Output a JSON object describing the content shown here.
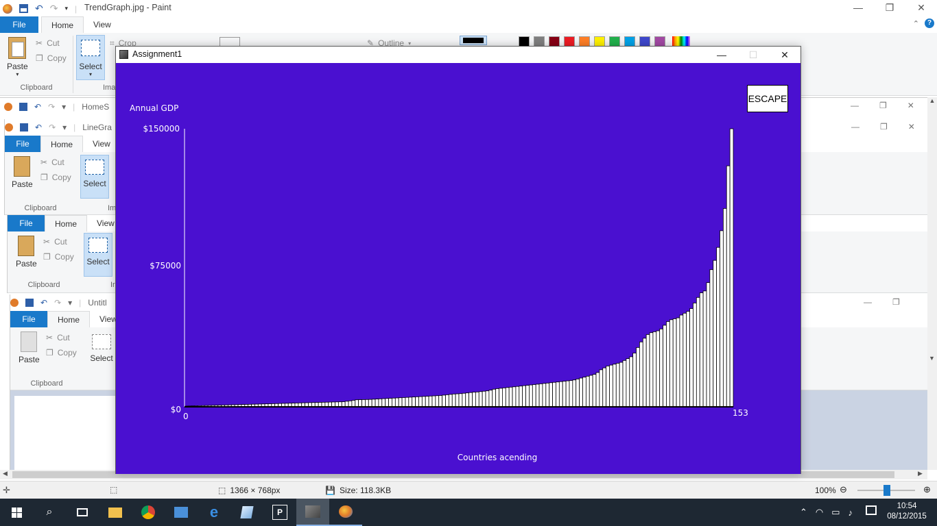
{
  "paint": {
    "title": "TrendGraph.jpg - Paint",
    "tabs": {
      "file": "File",
      "home": "Home",
      "view": "View"
    },
    "clipboard": {
      "paste": "Paste",
      "cut": "Cut",
      "copy": "Copy",
      "group": "Clipboard"
    },
    "image": {
      "select": "Select",
      "crop": "Crop",
      "group_partial": "Ima"
    },
    "shapes": {
      "outline": "Outline"
    },
    "colors": [
      "#000000",
      "#7f7f7f",
      "#880015",
      "#ed1c24",
      "#ff7f27",
      "#fff200",
      "#22b14c",
      "#00a2e8",
      "#3f48cc",
      "#a349a4"
    ]
  },
  "bg_windows": [
    {
      "title": "HomeS",
      "tabs": [
        "File",
        "Home",
        "View"
      ]
    },
    {
      "title": "LineGra",
      "tabs": [
        "File",
        "Home",
        "View"
      ],
      "clipboard": {
        "paste": "Paste",
        "cut": "Cut",
        "copy": "Copy",
        "group": "Clipboard"
      },
      "select": "Select",
      "ima": "Im"
    },
    {
      "title": "",
      "tabs": [
        "File",
        "Home",
        "View"
      ],
      "clipboard": {
        "paste": "Paste",
        "cut": "Cut",
        "copy": "Copy",
        "group": "Clipboard"
      },
      "select": "Select",
      "ima": "Ir"
    },
    {
      "title": "Untitl",
      "tabs": [
        "File",
        "Home",
        "View"
      ],
      "clipboard": {
        "paste": "Paste",
        "cut": "Cut",
        "copy": "Copy",
        "group": "Clipboard"
      },
      "select": "Select"
    }
  ],
  "app": {
    "title": "Assignment1",
    "escape_label": "ESCAPE",
    "bg_color": "#4a10d0"
  },
  "chart_data": {
    "type": "bar",
    "title": "",
    "ylabel": "Annual GDP",
    "xlabel": "Countries acending",
    "ylim": [
      0,
      150000
    ],
    "yticks": [
      "$150000",
      "$75000",
      "$0"
    ],
    "xticks": [
      "0",
      "153"
    ],
    "n_bars": 153,
    "values": [
      400,
      450,
      500,
      550,
      600,
      650,
      700,
      750,
      800,
      850,
      900,
      950,
      1000,
      1050,
      1100,
      1150,
      1200,
      1250,
      1300,
      1350,
      1400,
      1450,
      1500,
      1550,
      1600,
      1650,
      1700,
      1750,
      1800,
      1850,
      1900,
      1950,
      2000,
      2050,
      2100,
      2150,
      2200,
      2250,
      2300,
      2350,
      2400,
      2450,
      2500,
      2550,
      2600,
      2650,
      2700,
      2750,
      3000,
      3200,
      3500,
      3800,
      3850,
      3900,
      3950,
      4000,
      4100,
      4200,
      4300,
      4400,
      4500,
      4600,
      4700,
      4800,
      4900,
      5000,
      5100,
      5200,
      5300,
      5400,
      5500,
      5600,
      5700,
      5800,
      5900,
      6000,
      6100,
      6300,
      6500,
      6700,
      6900,
      7000,
      7100,
      7300,
      7500,
      7700,
      7900,
      8000,
      8200,
      8400,
      8600,
      9000,
      9500,
      9800,
      10000,
      10200,
      10400,
      10600,
      10800,
      11000,
      11200,
      11400,
      11600,
      11800,
      12000,
      12200,
      12400,
      12600,
      12800,
      13000,
      13200,
      13400,
      13600,
      13800,
      14000,
      14200,
      14500,
      15000,
      15500,
      16000,
      16500,
      17000,
      17500,
      18500,
      20000,
      21000,
      22000,
      22500,
      23000,
      23500,
      24000,
      25000,
      26000,
      27000,
      29000,
      32000,
      35000,
      37000,
      39000,
      40000,
      40500,
      41000,
      42000,
      44000,
      46000,
      47000,
      47500,
      48000,
      49500,
      50500,
      51500,
      53000,
      56000,
      59000,
      61500,
      62500,
      67000,
      74000,
      79000,
      86000,
      95000,
      107000,
      130000,
      150000
    ],
    "bar_color": "#ffffff"
  },
  "status": {
    "dimensions": "1366 × 768px",
    "size": "Size: 118.3KB",
    "zoom": "100%"
  },
  "taskbar": {
    "time": "10:54",
    "date": "08/12/2015"
  }
}
